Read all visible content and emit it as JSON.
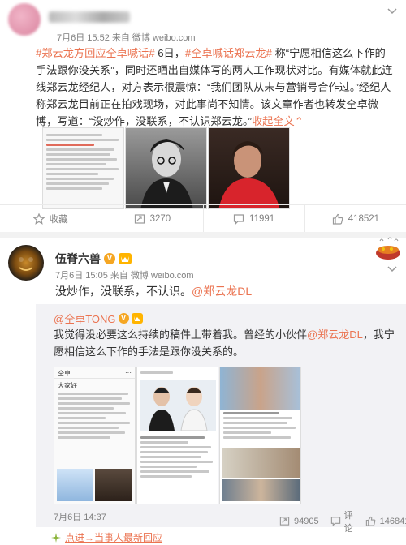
{
  "post1": {
    "meta": "7月6日 15:52 来自 微博 weibo.com",
    "text_segments": [
      {
        "t": "#郑云龙方回应仝卓喊话#",
        "link": true
      },
      {
        "t": " 6日，",
        "link": false
      },
      {
        "t": "#仝卓喊话郑云龙#",
        "link": true
      },
      {
        "t": " 称“宁愿相信这么下作的手法跟你没关系”，同时还晒出自媒体写的两人工作现状对比。有媒体就此连线郑云龙经纪人，对方表示很震惊：“我们团队从未与营销号合作过。”经纪人称郑云龙目前正在拍戏现场，对此事尚不知情。该文章作者也转发仝卓微博，写道：“没炒作，没联系，不认识郑云龙。”",
        "link": false
      },
      {
        "t": "收起全文",
        "link": true
      },
      {
        "t": "⌃",
        "link": true
      }
    ],
    "actions": {
      "favorite": "收藏",
      "repost": "3270",
      "comment": "11991",
      "like": "418521"
    }
  },
  "post2": {
    "username": "伍脊六兽",
    "vip_badge": "V",
    "meta": "7月6日 15:05 来自 微博 weibo.com",
    "text_plain": "没炒作，没联系，不认识。",
    "mention": "@郑云龙DL",
    "repost": {
      "author": "@仝卓TONG",
      "author_badge": "V",
      "text_before": "我觉得没必要这么持续的稿件上带着我。曾经的小伙伴",
      "mention": "@郑云龙DL",
      "text_after": "，我宁愿相信这么下作的手法是跟你没关系的。",
      "thumb_header": "仝卓",
      "thumb_caption": "大家好",
      "time": "7月6日 14:37",
      "reposts": "94905",
      "comment_label": "评论",
      "likes": "146841"
    }
  },
  "footer": {
    "label": "点进→当事人最新回应"
  },
  "colors": {
    "link": "#eb7350",
    "muted": "#808080",
    "repost_bg": "#f2f2f5"
  }
}
